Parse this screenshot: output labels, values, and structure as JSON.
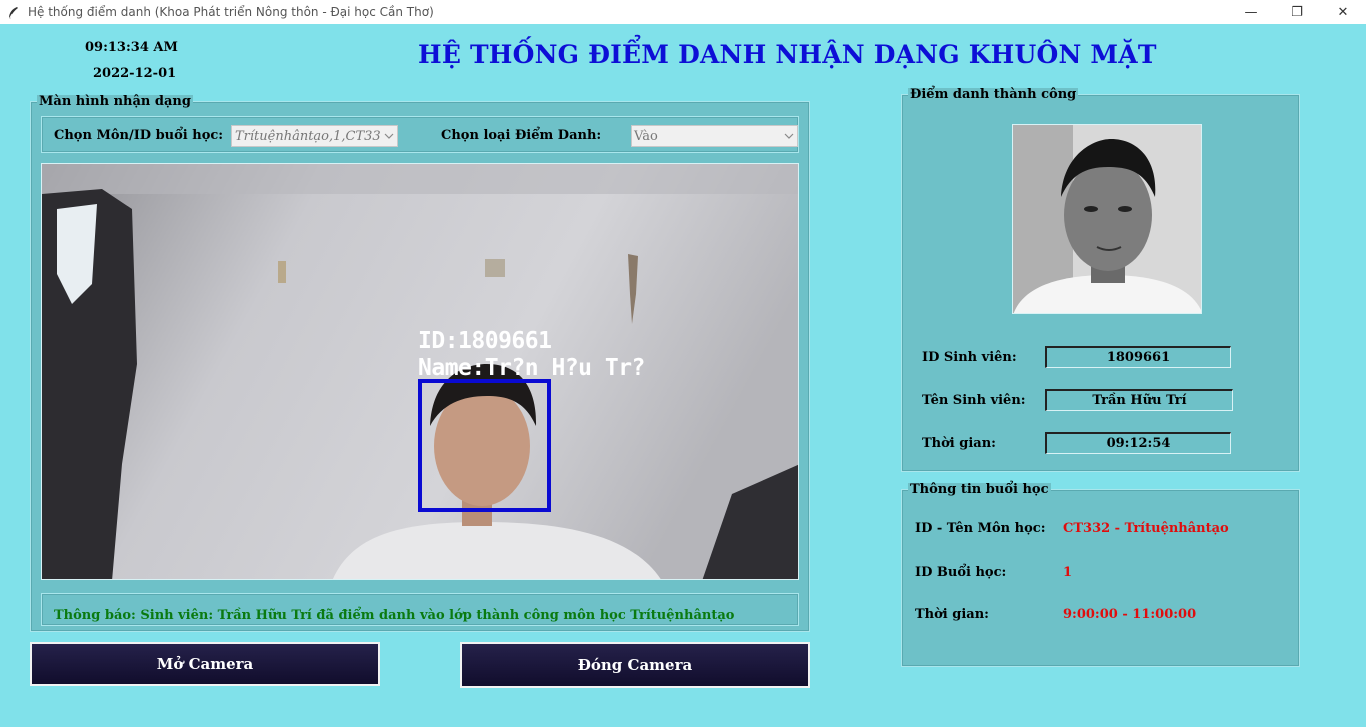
{
  "window": {
    "title": "Hệ thống điểm danh (Khoa Phát triển Nông thôn - Đại học Cần Thơ)",
    "minimize": "—",
    "maximize": "❐",
    "close": "✕"
  },
  "clock": {
    "time": "09:13:34 AM",
    "date": "2022-12-01"
  },
  "header": {
    "title": "HỆ THỐNG ĐIỂM DANH NHẬN DẠNG KHUÔN MẶT"
  },
  "recognition": {
    "legend": "Màn hình nhận dạng",
    "subject_label": "Chọn Môn/ID buổi học:",
    "subject_value": "Trítuệnhântạo,1,CT33",
    "type_label": "Chọn loại Điểm Danh:",
    "type_value": "Vào",
    "overlay_id": "ID:1809661",
    "overlay_name": "Name:Tr?n H?u Tr?",
    "notice": "Thông báo: Sinh viên: Trần Hữu Trí đã điểm danh vào lớp thành công môn học Trítuệnhântạo"
  },
  "buttons": {
    "open_camera": "Mở Camera",
    "close_camera": "Đóng Camera"
  },
  "success": {
    "legend": "Điểm danh thành công",
    "id_label": "ID Sinh viên:",
    "id_value": "1809661",
    "name_label": "Tên Sinh viên:",
    "name_value": "Trần Hữu Trí",
    "time_label": "Thời gian:",
    "time_value": "09:12:54"
  },
  "session": {
    "legend": "Thông tin buổi học",
    "subject_label": "ID - Tên Môn học:",
    "subject_value": "CT332 - Trítuệnhântạo",
    "session_label": "ID Buổi học:",
    "session_value": "1",
    "time_label": "Thời gian:",
    "time_value": "9:00:00 - 11:00:00"
  },
  "colors": {
    "background": "#80e1ea",
    "frame": "#6ec1c8",
    "title": "#0d0fd6",
    "notice": "#0a7a10",
    "session_value": "#e00d0d",
    "face_box": "#0a0ad2",
    "button": "#1a1638"
  },
  "icons": [
    "feather-app-icon",
    "minimize-icon",
    "maximize-icon",
    "close-icon",
    "chevron-down-icon"
  ]
}
